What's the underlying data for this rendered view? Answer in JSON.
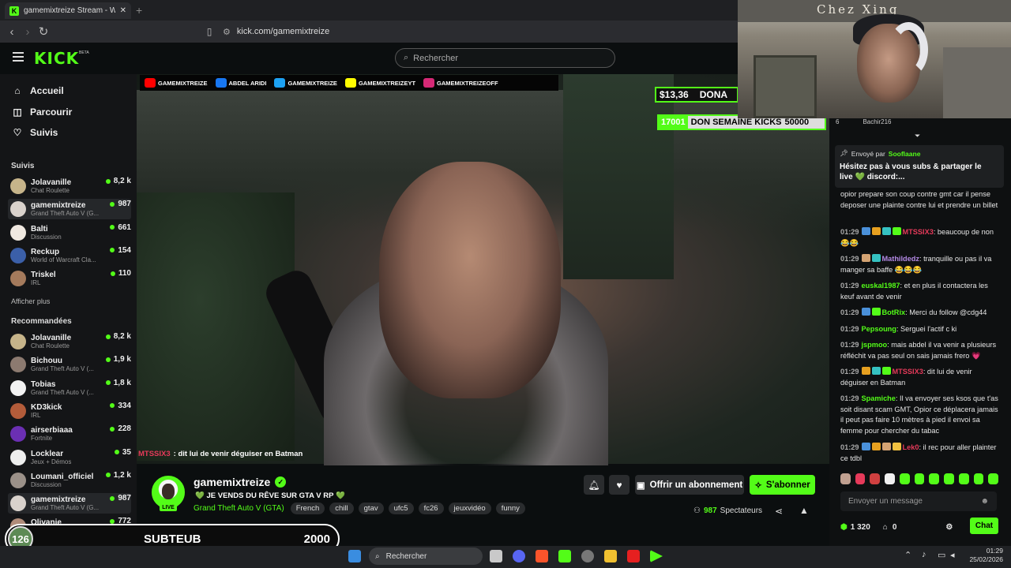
{
  "browser": {
    "tab_title": "gamemixtreize Stream - Watch Li",
    "new_tab": "+",
    "url": "kick.com/gamemixtreize"
  },
  "header": {
    "logo": "KICK",
    "beta": "BETA",
    "search_placeholder": "Rechercher"
  },
  "sidebar": {
    "nav": [
      {
        "label": "Accueil",
        "icon": "home-icon"
      },
      {
        "label": "Parcourir",
        "icon": "compass-icon"
      },
      {
        "label": "Suivis",
        "icon": "heart-icon"
      }
    ],
    "followed_title": "Suivis",
    "followed": [
      {
        "name": "Jolavanille",
        "category": "Chat Roulette",
        "viewers": "8,2 k",
        "color": "#c6b48a"
      },
      {
        "name": "gamemixtreize",
        "category": "Grand Theft Auto V (G...",
        "viewers": "987",
        "color": "#d9d2cc"
      },
      {
        "name": "Balti",
        "category": "Discussion",
        "viewers": "661",
        "color": "#efe8e0"
      },
      {
        "name": "Reckup",
        "category": "World of Warcraft Cla...",
        "viewers": "154",
        "color": "#3b5fa8"
      },
      {
        "name": "Triskel",
        "category": "IRL",
        "viewers": "110",
        "color": "#a47a5c"
      }
    ],
    "show_more": "Afficher plus",
    "recommended_title": "Recommandées",
    "recommended": [
      {
        "name": "Jolavanille",
        "category": "Chat Roulette",
        "viewers": "8,2 k",
        "color": "#c6b48a"
      },
      {
        "name": "Bichouu",
        "category": "Grand Theft Auto V (...",
        "viewers": "1,9 k",
        "color": "#8c7a70"
      },
      {
        "name": "Tobias",
        "category": "Grand Theft Auto V (...",
        "viewers": "1,8 k",
        "color": "#f2f2f2"
      },
      {
        "name": "KD3kick",
        "category": "IRL",
        "viewers": "334",
        "color": "#b35c3a"
      },
      {
        "name": "airserbiaaa",
        "category": "Fortnite",
        "viewers": "228",
        "color": "#6b2fb3"
      },
      {
        "name": "Locklear",
        "category": "Jeux + Démos",
        "viewers": "35",
        "color": "#eeeeee"
      },
      {
        "name": "Loumani_officiel",
        "category": "Discussion",
        "viewers": "1,2 k",
        "color": "#9a9088"
      },
      {
        "name": "gamemixtreize",
        "category": "Grand Theft Auto V (G...",
        "viewers": "987",
        "color": "#d9d2cc"
      },
      {
        "name": "Olivanie",
        "category": "Grand Theft Auto V (G...",
        "viewers": "772",
        "color": "#b08c7a"
      }
    ]
  },
  "sub_goal": {
    "count": "126",
    "label": "SUBTEUB",
    "goal": "2000",
    "progress_fraction": 0.063
  },
  "video": {
    "socials": [
      {
        "label": "GAMEMIXTREIZE",
        "small": "YOUTUBE",
        "color": "#ff0000"
      },
      {
        "label": "ABDEL ARIDI",
        "small": "FACEBOOK",
        "color": "#1877f2"
      },
      {
        "label": "GAMEMIXTREIZE",
        "small": "TWITTER",
        "color": "#1da1f2"
      },
      {
        "label": "GAMEMIXTREIZEYT",
        "small": "SNAPCHAT",
        "color": "#fffc00"
      },
      {
        "label": "GAMEMIXTREIZEOFF",
        "small": "INSTAGRAM",
        "color": "#d62976"
      }
    ],
    "donation_amount": "$13,36",
    "donation_label": "DONA",
    "kicks_number": "17001",
    "kicks_label": "DON SEMAINE KICKS",
    "kicks_goal": "50000",
    "caption_user": "MTSSIX3",
    "caption_text": ": dit lui de venir déguiser en Batman",
    "cam_banner": "Chez Xing"
  },
  "channel": {
    "name": "gamemixtreize",
    "live": "LIVE",
    "title": "💚 JE VENDS DU RÊVE SUR GTA V RP 💚",
    "game": "Grand Theft Auto V (GTA)",
    "tags": [
      "French",
      "chill",
      "gtav",
      "ufc5",
      "fc26",
      "jeuxvidéo",
      "funny"
    ],
    "gift_button": "Offrir un abonnement",
    "subscribe_button": "S'abonner",
    "viewers_count": "987",
    "viewers_label": "Spectateurs"
  },
  "chat": {
    "top_user": "Bachir216",
    "top_count": "6",
    "pinned_by_label": "Envoyé par",
    "pinned_by_user": "Sooflaane",
    "pinned_message": "Hésitez pas à vous subs & partager le live 💚 discord:...",
    "messages": [
      {
        "time": "",
        "user": "",
        "user_color": "#ddd",
        "text": "opior prepare son coup contre gmt car il pense deposer une plainte contre lui et prendre un billet"
      },
      {
        "time": "01:29",
        "user": "MTSSIX3",
        "user_color": "#e63a5a",
        "text": ": beaucoup de non 😂😂",
        "badges": [
          "#4a90d9",
          "#e6a020",
          "#35c1c1",
          "#53fc18"
        ]
      },
      {
        "time": "01:29",
        "user": "Mathildedz",
        "user_color": "#b48ae6",
        "text": ": tranquille ou pas il va manger sa baffe 😂😂😂",
        "badges": [
          "#d4a373",
          "#35c1c1"
        ]
      },
      {
        "time": "01:29",
        "user": "euskal1987",
        "user_color": "#53fc18",
        "text": ": et en plus il contactera les keuf avant de venir"
      },
      {
        "time": "01:29",
        "user": "BotRix",
        "user_color": "#53fc18",
        "text": ": Merci du follow @cdg44",
        "badges": [
          "#4a90d9",
          "#53fc18"
        ]
      },
      {
        "time": "01:29",
        "user": "Pepsoung",
        "user_color": "#53fc18",
        "text": ": Serguei l'actif c ki"
      },
      {
        "time": "01:29",
        "user": "jspmoo",
        "user_color": "#53fc18",
        "text": ": mais abdel il va venir a plusieurs réfléchit va pas seul on sais jamais frero 💗"
      },
      {
        "time": "01:29",
        "user": "MTSSIX3",
        "user_color": "#e63a5a",
        "text": ": dit lui de venir déguiser en Batman",
        "badges": [
          "#e6a020",
          "#35c1c1",
          "#53fc18"
        ]
      },
      {
        "time": "01:29",
        "user": "Spamiche",
        "user_color": "#53fc18",
        "text": ": Il va envoyer ses ksos que t'as soit disant scam GMT, Opior ce déplacera jamais il peut pas faire 10 mètres à pied il envoi sa femme pour chercher du tabac"
      },
      {
        "time": "01:29",
        "user": "Lek0",
        "user_color": "#e63a5a",
        "text": ": il rec pour aller plainter ce tdbl",
        "badges": [
          "#4a90d9",
          "#e6a020",
          "#d4a373",
          "#f0c040"
        ]
      }
    ],
    "input_placeholder": "Envoyer un message",
    "kicks_balance": "1 320",
    "gift_count": "0",
    "chat_button": "Chat"
  },
  "taskbar": {
    "search": "Rechercher",
    "time": "01:29",
    "date": "25/02/2026"
  }
}
